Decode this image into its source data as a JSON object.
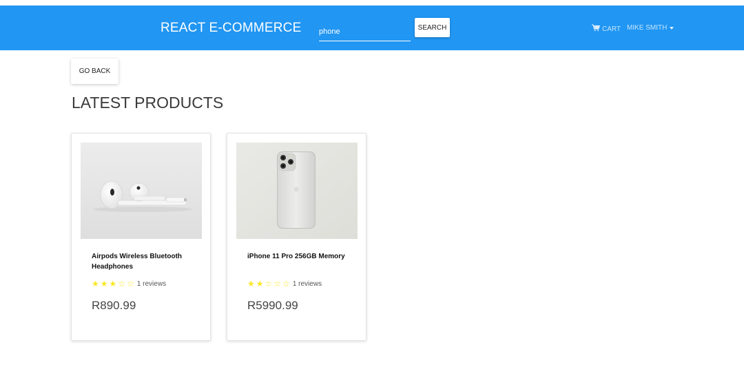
{
  "navbar": {
    "brand": "REACT E-COMMERCE",
    "search_value": "phone",
    "search_button": "SEARCH",
    "cart_label": "CART",
    "user_label": "MIKE SMITH",
    "cart_icon": "shopping-cart-icon",
    "user_icon": "caret-down-icon"
  },
  "go_back_label": "GO BACK",
  "section_title": "LATEST PRODUCTS",
  "colors": {
    "navbar_bg": "#2196f3",
    "star": "#f8e825"
  },
  "products": [
    {
      "name": "Airpods Wireless Bluetooth Headphones",
      "rating": 3,
      "reviews": "1 reviews",
      "price": "R890.99",
      "image": "airpods-image"
    },
    {
      "name": "iPhone 11 Pro 256GB Memory",
      "rating": 2,
      "reviews": "1 reviews",
      "price": "R5990.99",
      "image": "iphone-image"
    }
  ]
}
